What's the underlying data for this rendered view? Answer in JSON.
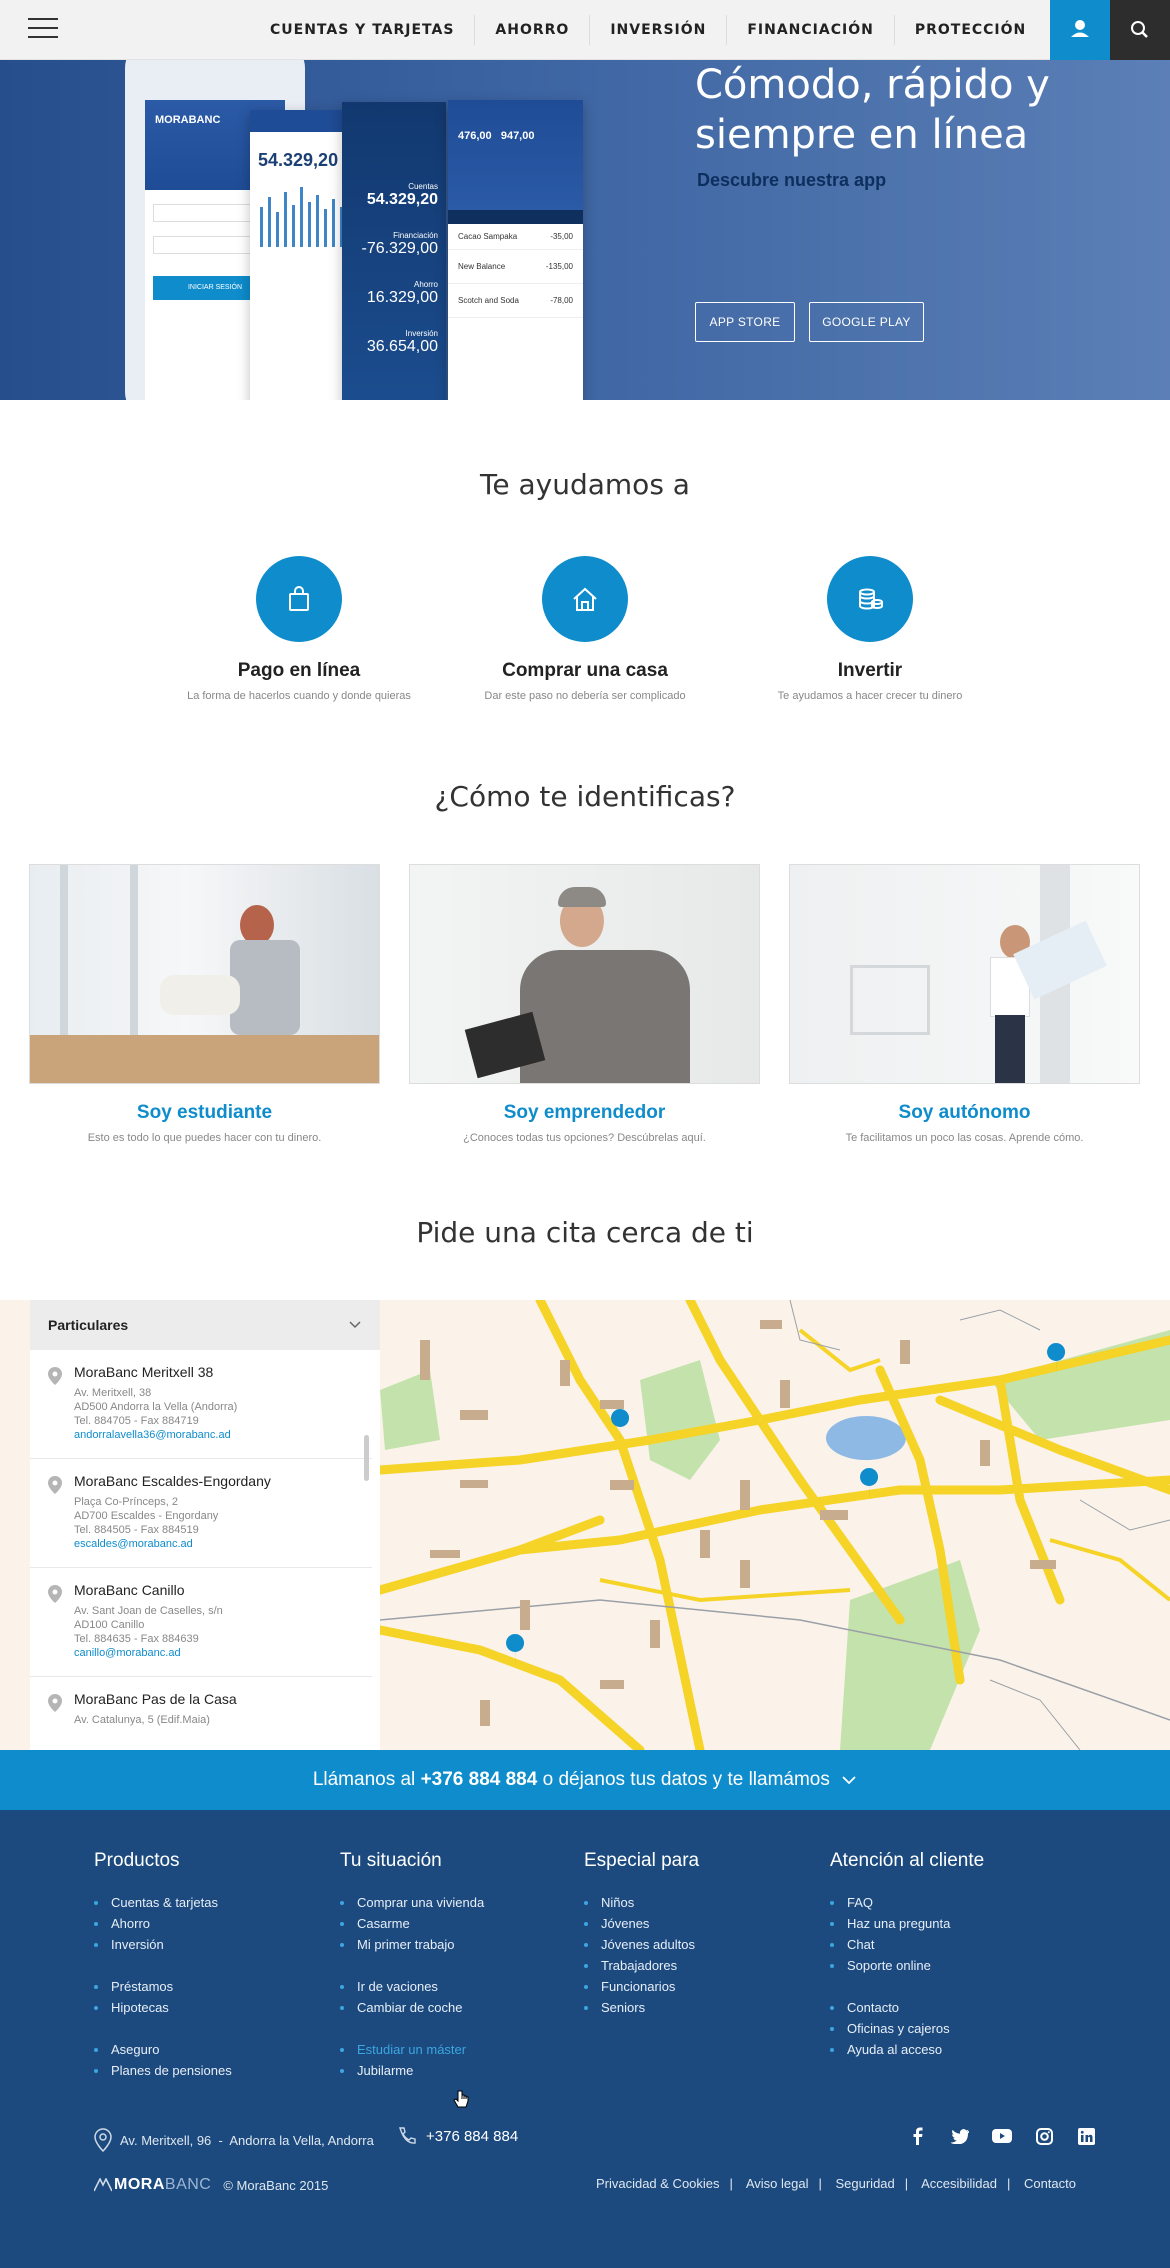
{
  "header": {
    "nav": [
      "CUENTAS Y TARJETAS",
      "AHORRO",
      "INVERSIÓN",
      "FINANCIACIÓN",
      "PROTECCIÓN"
    ]
  },
  "hero": {
    "title": "Cómodo, rápido y siempre en línea",
    "subtitle": "Descubre nuestra app",
    "app_store": "APP STORE",
    "google_play": "GOOGLE PLAY",
    "mock": {
      "brand": "MORABANC",
      "balance_big": "54.329,20",
      "cuentas_label": "Cuentas",
      "cuentas_value": "54.329,20",
      "financiacion_label": "Financiación",
      "financiacion_value": "-76.329,00",
      "ahorro_label": "Ahorro",
      "ahorro_value": "16.329,00",
      "inversion_label": "Inversión",
      "inversion_value": "36.654,00",
      "top_a": "476,00",
      "top_b": "947,00",
      "tx": [
        {
          "name": "Cacao Sampaka",
          "amount": "-35,00"
        },
        {
          "name": "New Balance",
          "amount": "-135,00"
        },
        {
          "name": "Scotch and Soda",
          "amount": "-78,00"
        }
      ],
      "login_btn": "INICIAR SESIÓN"
    }
  },
  "help": {
    "title": "Te ayudamos a",
    "items": [
      {
        "label": "Pago en línea",
        "desc": "La forma de hacerlos cuando y donde quieras"
      },
      {
        "label": "Comprar una casa",
        "desc": "Dar este paso no debería ser complicado"
      },
      {
        "label": "Invertir",
        "desc": "Te ayudamos a hacer crecer tu dinero"
      }
    ]
  },
  "identity": {
    "title": "¿Cómo te identificas?",
    "items": [
      {
        "name": "Soy estudiante",
        "desc": "Esto es todo lo que puedes hacer con tu dinero."
      },
      {
        "name": "Soy emprendedor",
        "desc": "¿Conoces todas tus opciones? Descúbrelas aquí."
      },
      {
        "name": "Soy autónomo",
        "desc": "Te facilitamos un poco las cosas. Aprende cómo."
      }
    ]
  },
  "appointment": {
    "title": "Pide una cita cerca de ti",
    "select": "Particulares",
    "offices": [
      {
        "name": "MoraBanc Meritxell 38",
        "l1": "Av. Meritxell, 38",
        "l2": "AD500 Andorra la Vella (Andorra)",
        "l3": "Tel. 884705 - Fax 884719",
        "mail": "andorralavella36@morabanc.ad"
      },
      {
        "name": "MoraBanc Escaldes-Engordany",
        "l1": "Plaça Co-Prínceps, 2",
        "l2": "AD700 Escaldes - Engordany",
        "l3": "Tel. 884505 - Fax 884519",
        "mail": "escaldes@morabanc.ad"
      },
      {
        "name": "MoraBanc Canillo",
        "l1": "Av. Sant Joan de Caselles, s/n",
        "l2": "AD100 Canillo",
        "l3": "Tel. 884635 - Fax 884639",
        "mail": "canillo@morabanc.ad"
      },
      {
        "name": "MoraBanc Pas de la Casa",
        "l1": "Av. Catalunya, 5 (Edif.Maia)",
        "l2": "",
        "l3": "",
        "mail": ""
      }
    ]
  },
  "callbar": {
    "pre": "Llámanos al ",
    "phone": "+376 884 884",
    "post": " o déjanos tus datos y te llamámos"
  },
  "footer": {
    "cols": [
      {
        "title": "Productos",
        "items": [
          "Cuentas & tarjetas",
          "Ahorro",
          "Inversión",
          "Préstamos",
          "Hipotecas",
          "Aseguro",
          "Planes de pensiones"
        ]
      },
      {
        "title": "Tu situación",
        "items": [
          "Comprar una vivienda",
          "Casarme",
          "Mi primer trabajo",
          "Ir de vaciones",
          "Cambiar de coche",
          "Estudiar un máster",
          "Jubilarme"
        ]
      },
      {
        "title": "Especial para",
        "items": [
          "Niños",
          "Jóvenes",
          "Jóvenes adultos",
          "Trabajadores",
          "Funcionarios",
          "Seniors"
        ]
      },
      {
        "title": "Atención al cliente",
        "items": [
          "FAQ",
          "Haz una pregunta",
          "Chat",
          "Soporte online",
          "Contacto",
          "Oficinas y cajeros",
          "Ayuda al acceso"
        ]
      }
    ],
    "address": "Av. Meritxell, 96  -  Andorra la Vella, Andorra",
    "phone": "+376 884 884",
    "logo_a": "MORA",
    "logo_b": "BANC",
    "copyright": "© MoraBanc 2015",
    "legal": [
      "Privacidad & Cookies",
      "Aviso legal",
      "Seguridad",
      "Accesibilidad",
      "Contacto"
    ]
  },
  "colors": {
    "accent": "#0e8ccc",
    "footer": "#1c4a7e",
    "map_road": "#f5d327",
    "map_park": "#c4e2ac"
  }
}
